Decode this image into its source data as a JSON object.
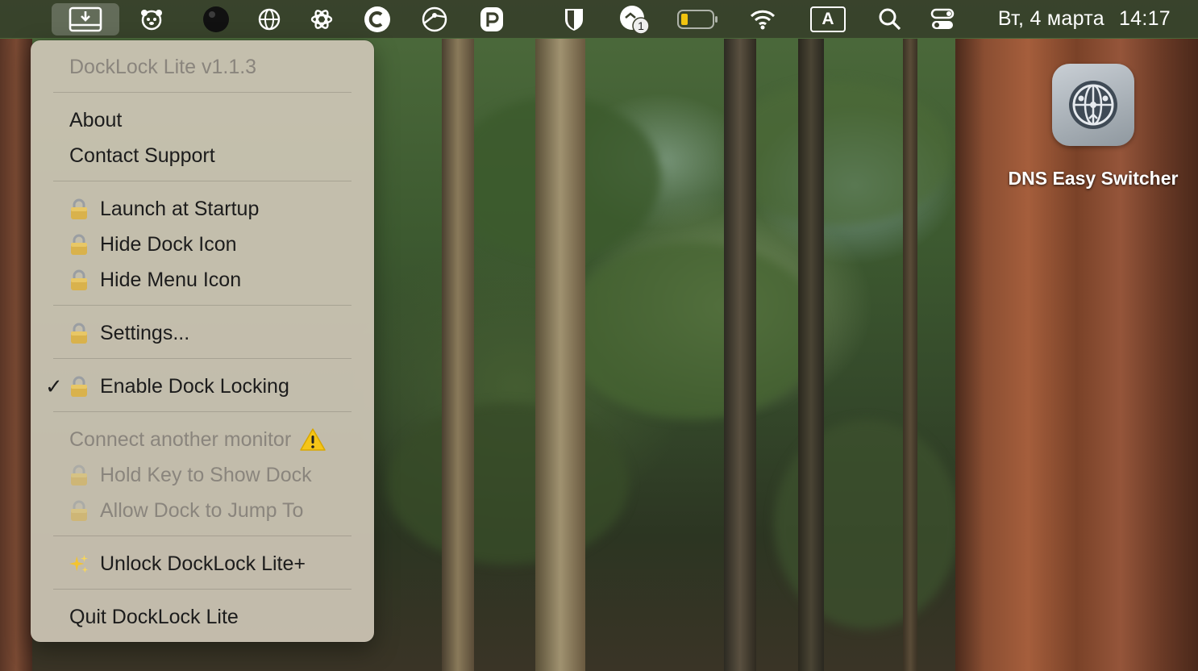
{
  "menubar": {
    "icons": [
      {
        "name": "docklock-download-icon",
        "active": true
      },
      {
        "name": "bear-face-icon"
      },
      {
        "name": "black-circle-icon"
      },
      {
        "name": "globe-network-icon"
      },
      {
        "name": "openai-icon"
      },
      {
        "name": "c-letter-icon"
      },
      {
        "name": "dns-globe-icon"
      },
      {
        "name": "p-refresh-icon"
      },
      {
        "name": "shield-icon"
      },
      {
        "name": "notification-cloud-icon",
        "badge": "1"
      },
      {
        "name": "battery-icon"
      },
      {
        "name": "wifi-icon"
      },
      {
        "name": "input-source-icon",
        "label": "A"
      },
      {
        "name": "search-icon"
      },
      {
        "name": "control-center-icon"
      }
    ],
    "date": "Вт, 4 марта",
    "time": "14:17"
  },
  "menu": {
    "title": "DockLock Lite v1.1.3",
    "about": "About",
    "contact_support": "Contact Support",
    "launch_at_startup": "Launch at Startup",
    "hide_dock_icon": "Hide Dock Icon",
    "hide_menu_icon": "Hide Menu Icon",
    "settings": "Settings...",
    "enable_dock_locking": "Enable Dock Locking",
    "enable_dock_locking_checked": true,
    "connect_monitor": "Connect another monitor",
    "hold_key": "Hold Key to Show Dock",
    "allow_jump": "Allow Dock to Jump To",
    "unlock_plus": "Unlock DockLock Lite+",
    "quit": "Quit DockLock Lite"
  },
  "desktop": {
    "icon_label": "DNS Easy Switcher"
  }
}
